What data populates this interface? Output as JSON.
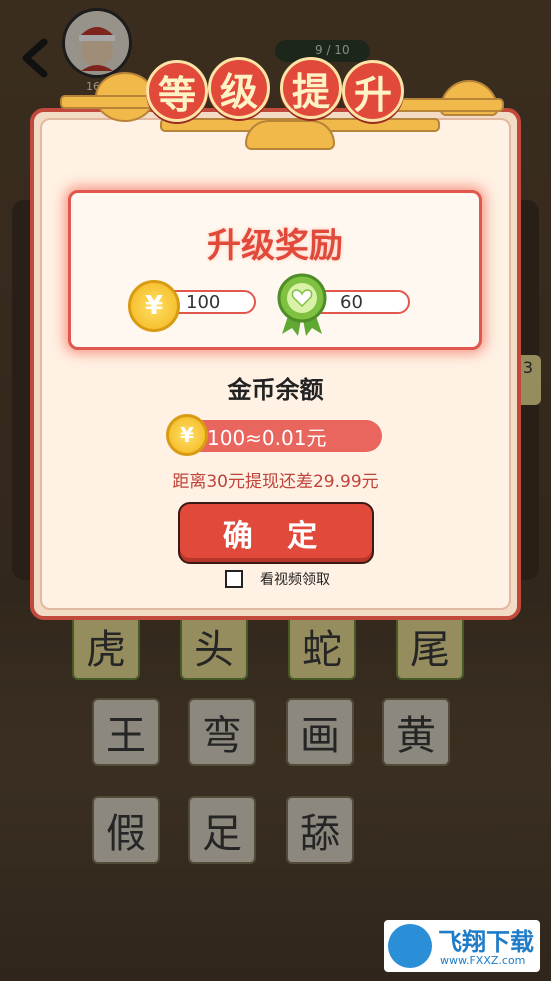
{
  "header": {
    "back_icon": "chevron-left-icon",
    "level_label": "16",
    "progress_text": "9 / 10"
  },
  "board": {
    "row1": [
      "虎",
      "头",
      "蛇",
      "尾"
    ],
    "row2": [
      "王",
      "弯",
      "画",
      "黄"
    ],
    "row3": [
      "假",
      "足",
      "舔"
    ],
    "side_badge": "3"
  },
  "dialog": {
    "title_chars": [
      "等",
      "级",
      "提",
      "升"
    ],
    "reward_title": "升级奖励",
    "coin_reward": "100",
    "heart_reward": "60",
    "coin_symbol": "¥",
    "balance_title": "金币余额",
    "balance_value": "100≈0.01元",
    "distance_text": "距离30元提现还差29.99元",
    "confirm_label": "确 定",
    "video_label": "看视频领取"
  },
  "watermark": {
    "brand": "飞翔下载",
    "url": "www.FXXZ.com"
  },
  "colors": {
    "accent": "#e14a3b",
    "panel_bg": "#fff1e4",
    "coin": "#f2b51c",
    "badge_green": "#7fc241"
  }
}
